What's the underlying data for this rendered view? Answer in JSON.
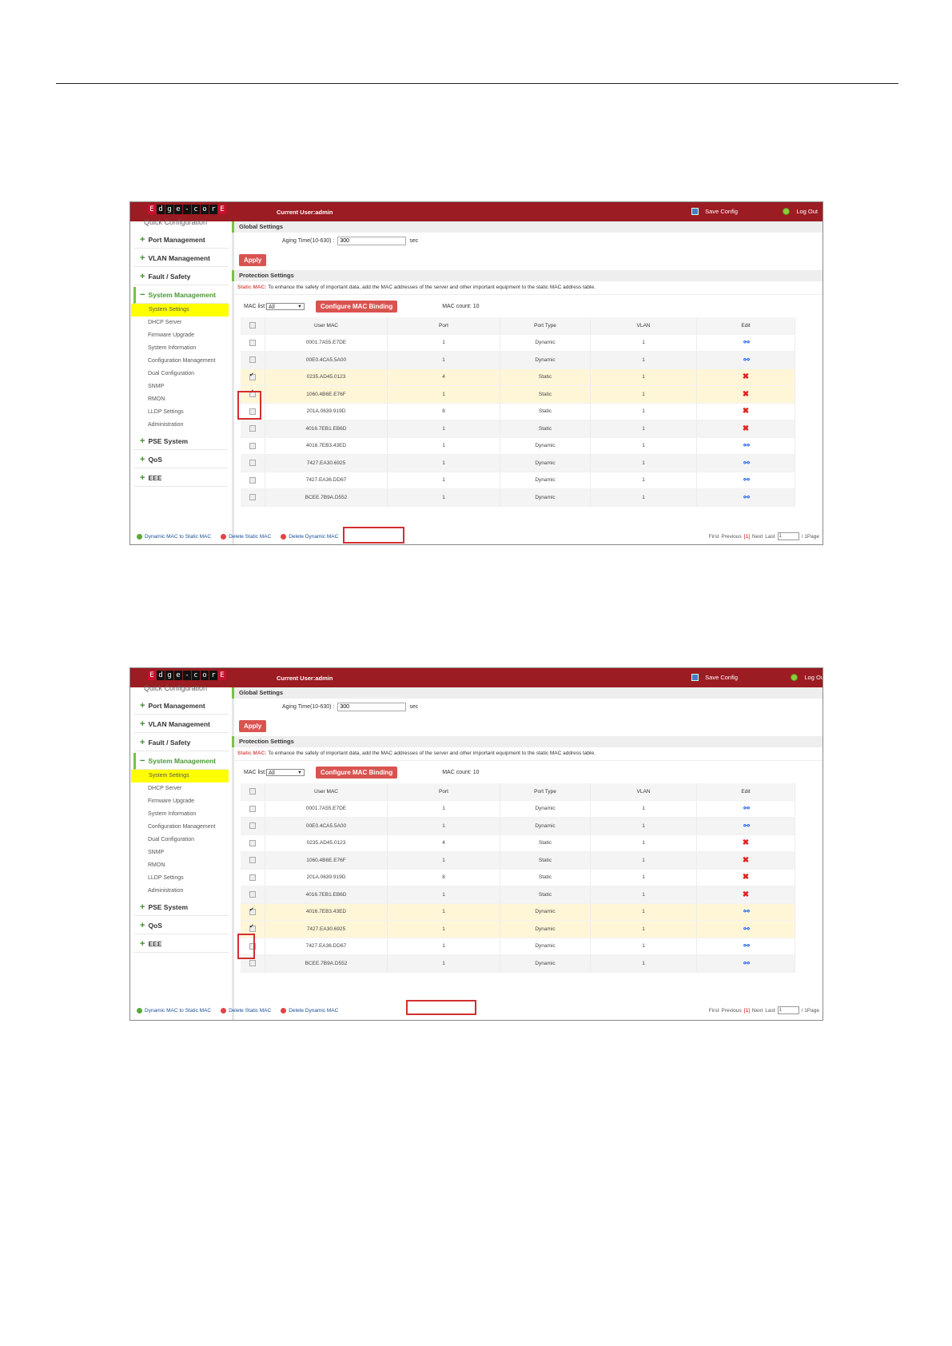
{
  "header": {
    "user": "Current User:admin",
    "save": "Save Config",
    "logout": "Log Out",
    "logout_cut": "Log Ou"
  },
  "logo_letters": [
    "E",
    "d",
    "g",
    "e",
    "-",
    "c",
    "o",
    "r",
    "E"
  ],
  "sidebar": {
    "quick": "Quick Configuration",
    "port": "Port Management",
    "vlan": "VLAN Management",
    "fault": "Fault / Safety",
    "system": "System Management",
    "subs": [
      "System Settings",
      "DHCP Server",
      "Firmware Upgrade",
      "System Information",
      "Configuration Management",
      "Dual Configuration",
      "SNMP",
      "RMON",
      "LLDP Settings",
      "Administration"
    ],
    "pse": "PSE System",
    "qos": "QoS",
    "eee": "EEE"
  },
  "global": {
    "title": "Global Settings",
    "aging_label": "Aging Time(10-630) :",
    "aging_value": "300",
    "unit": "sec",
    "apply": "Apply"
  },
  "protection": {
    "title": "Protection Settings",
    "tip_label": "Static MAC:",
    "tip": "To enhance the safety of important data, add the MAC addresses of the server and other important equipment to the static MAC address table.",
    "mac_list": "MAC list:",
    "mac_list_value": "All",
    "configure": "Configure MAC Binding",
    "count": "MAC count: 10"
  },
  "columns": [
    "User MAC",
    "Port",
    "Port Type",
    "VLAN",
    "Edit"
  ],
  "rows": [
    {
      "mac": "0001.7A55.E7DE",
      "port": "1",
      "type": "Dynamic",
      "vlan": "1"
    },
    {
      "mac": "00E0.4CA5.5A00",
      "port": "1",
      "type": "Dynamic",
      "vlan": "1"
    },
    {
      "mac": "0235.AD45.0123",
      "port": "4",
      "type": "Static",
      "vlan": "1"
    },
    {
      "mac": "1060.4B6E.E76F",
      "port": "1",
      "type": "Static",
      "vlan": "1"
    },
    {
      "mac": "201A.0639.919D",
      "port": "8",
      "type": "Static",
      "vlan": "1"
    },
    {
      "mac": "4016.7EB1.EB6D",
      "port": "1",
      "type": "Static",
      "vlan": "1"
    },
    {
      "mac": "4016.7EB3.43ED",
      "port": "1",
      "type": "Dynamic",
      "vlan": "1"
    },
    {
      "mac": "7427.EA30.6925",
      "port": "1",
      "type": "Dynamic",
      "vlan": "1"
    },
    {
      "mac": "7427.EA36.DD67",
      "port": "1",
      "type": "Dynamic",
      "vlan": "1"
    },
    {
      "mac": "BCEE.7B9A.D552",
      "port": "1",
      "type": "Dynamic",
      "vlan": "1"
    }
  ],
  "footer": {
    "dyn_to_static": "Dynamic MAC to Static MAC",
    "del_static": "Delete Static MAC",
    "del_dynamic": "Delete Dynamic MAC",
    "first": "First",
    "previous": "Previous",
    "page": "[1]",
    "next": "Next",
    "last": "Last",
    "page_input": "1",
    "pages": "/ 1Page"
  },
  "screens": [
    {
      "checked": [
        2,
        3
      ],
      "logout_key": "logout"
    },
    {
      "checked": [
        6,
        7
      ],
      "logout_key": "logout_cut"
    }
  ]
}
